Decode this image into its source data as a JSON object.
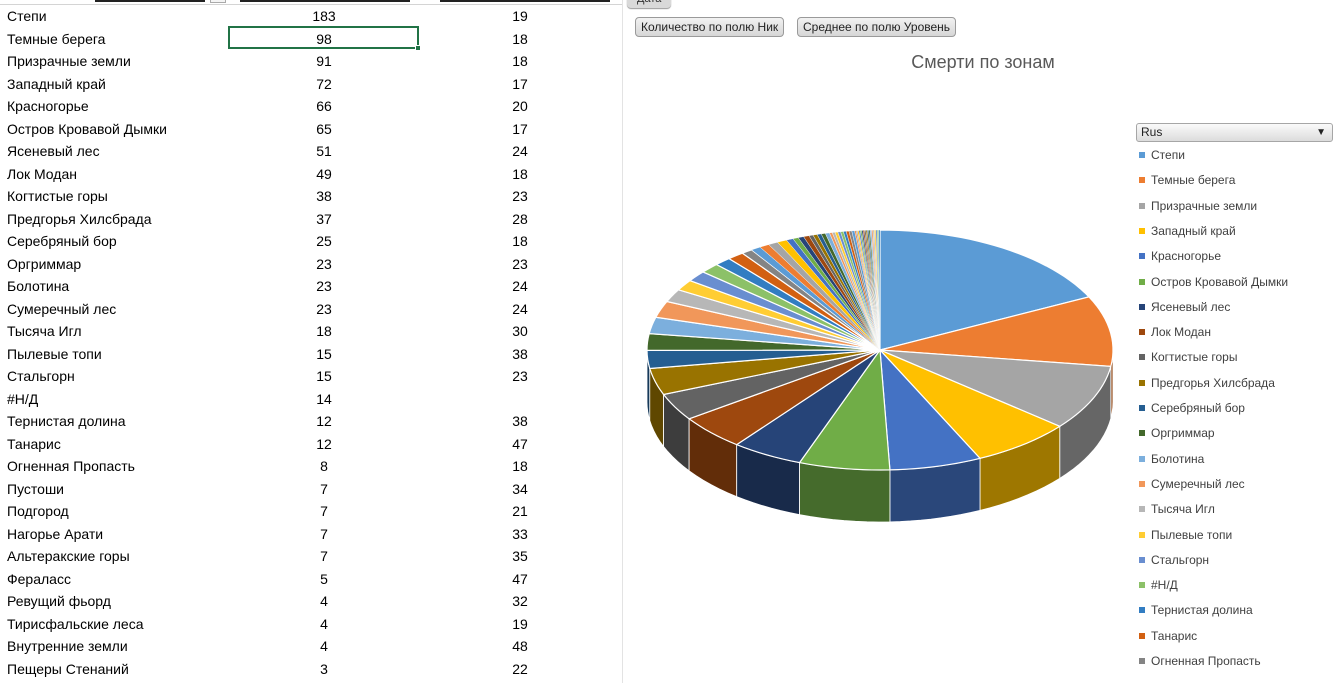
{
  "sheet": {
    "rows": [
      {
        "name": "Степи",
        "count": "183",
        "avg": "19"
      },
      {
        "name": "Темные берега",
        "count": "98",
        "avg": "18"
      },
      {
        "name": "Призрачные земли",
        "count": "91",
        "avg": "18"
      },
      {
        "name": "Западный край",
        "count": "72",
        "avg": "17"
      },
      {
        "name": "Красногорье",
        "count": "66",
        "avg": "20"
      },
      {
        "name": "Остров Кровавой Дымки",
        "count": "65",
        "avg": "17"
      },
      {
        "name": "Ясеневый лес",
        "count": "51",
        "avg": "24"
      },
      {
        "name": "Лок Модан",
        "count": "49",
        "avg": "18"
      },
      {
        "name": "Когтистые горы",
        "count": "38",
        "avg": "23"
      },
      {
        "name": "Предгорья Хилсбрада",
        "count": "37",
        "avg": "28"
      },
      {
        "name": "Серебряный бор",
        "count": "25",
        "avg": "18"
      },
      {
        "name": "Оргриммар",
        "count": "23",
        "avg": "23"
      },
      {
        "name": "Болотина",
        "count": "23",
        "avg": "24"
      },
      {
        "name": "Сумеречный лес",
        "count": "23",
        "avg": "24"
      },
      {
        "name": "Тысяча Игл",
        "count": "18",
        "avg": "30"
      },
      {
        "name": "Пылевые топи",
        "count": "15",
        "avg": "38"
      },
      {
        "name": "Стальгорн",
        "count": "15",
        "avg": "23"
      },
      {
        "name": "#Н/Д",
        "count": "14",
        "avg": ""
      },
      {
        "name": "Тернистая долина",
        "count": "12",
        "avg": "38"
      },
      {
        "name": "Танарис",
        "count": "12",
        "avg": "47"
      },
      {
        "name": "Огненная Пропасть",
        "count": "8",
        "avg": "18"
      },
      {
        "name": "Пустоши",
        "count": "7",
        "avg": "34"
      },
      {
        "name": "Подгород",
        "count": "7",
        "avg": "21"
      },
      {
        "name": "Нагорье Арати",
        "count": "7",
        "avg": "33"
      },
      {
        "name": "Альтеракские горы",
        "count": "7",
        "avg": "35"
      },
      {
        "name": "Фераласс",
        "count": "5",
        "avg": "47"
      },
      {
        "name": "Ревущий фьорд",
        "count": "4",
        "avg": "32"
      },
      {
        "name": "Тирисфальские леса",
        "count": "4",
        "avg": "19"
      },
      {
        "name": "Внутренние земли",
        "count": "4",
        "avg": "48"
      },
      {
        "name": "Пещеры Стенаний",
        "count": "3",
        "avg": "22"
      }
    ]
  },
  "chart_panel": {
    "data_button": "Дата",
    "field_buttons": [
      "Количество по полю Ник",
      "Среднее по полю Уровень"
    ],
    "legend_filter": "Rus",
    "colors": {
      "selection": "#217346",
      "palette": [
        "#5b9bd5",
        "#ed7d31",
        "#a5a5a5",
        "#ffc000",
        "#4472c4",
        "#70ad47",
        "#264478",
        "#9e480e",
        "#636363",
        "#997300",
        "#255e91",
        "#43682b",
        "#7cafdd",
        "#f1975a",
        "#b7b7b7",
        "#ffcd33",
        "#698ed0",
        "#8cc168",
        "#327dc2",
        "#d26012",
        "#848484"
      ]
    }
  },
  "chart_data": {
    "type": "pie",
    "title": "Смерти по зонам",
    "legend_position": "right",
    "categories": [
      "Степи",
      "Темные берега",
      "Призрачные земли",
      "Западный край",
      "Красногорье",
      "Остров Кровавой Дымки",
      "Ясеневый лес",
      "Лок Модан",
      "Когтистые горы",
      "Предгорья Хилсбрада",
      "Серебряный бор",
      "Оргриммар",
      "Болотина",
      "Сумеречный лес",
      "Тысяча Игл",
      "Пылевые топи",
      "Стальгорн",
      "#Н/Д",
      "Тернистая долина",
      "Танарис",
      "Огненная Пропасть"
    ],
    "values": [
      183,
      98,
      91,
      72,
      66,
      65,
      51,
      49,
      38,
      37,
      25,
      23,
      23,
      23,
      18,
      15,
      15,
      14,
      12,
      12,
      8
    ],
    "tail_values": [
      7,
      7,
      7,
      7,
      5,
      4,
      4,
      4,
      3,
      3,
      3,
      3,
      3,
      2,
      2,
      2,
      2,
      2,
      2,
      2,
      2,
      2,
      1,
      1,
      1,
      1,
      1,
      1,
      1,
      1,
      1,
      1,
      1,
      1,
      1,
      1,
      1,
      1,
      1,
      1
    ]
  }
}
